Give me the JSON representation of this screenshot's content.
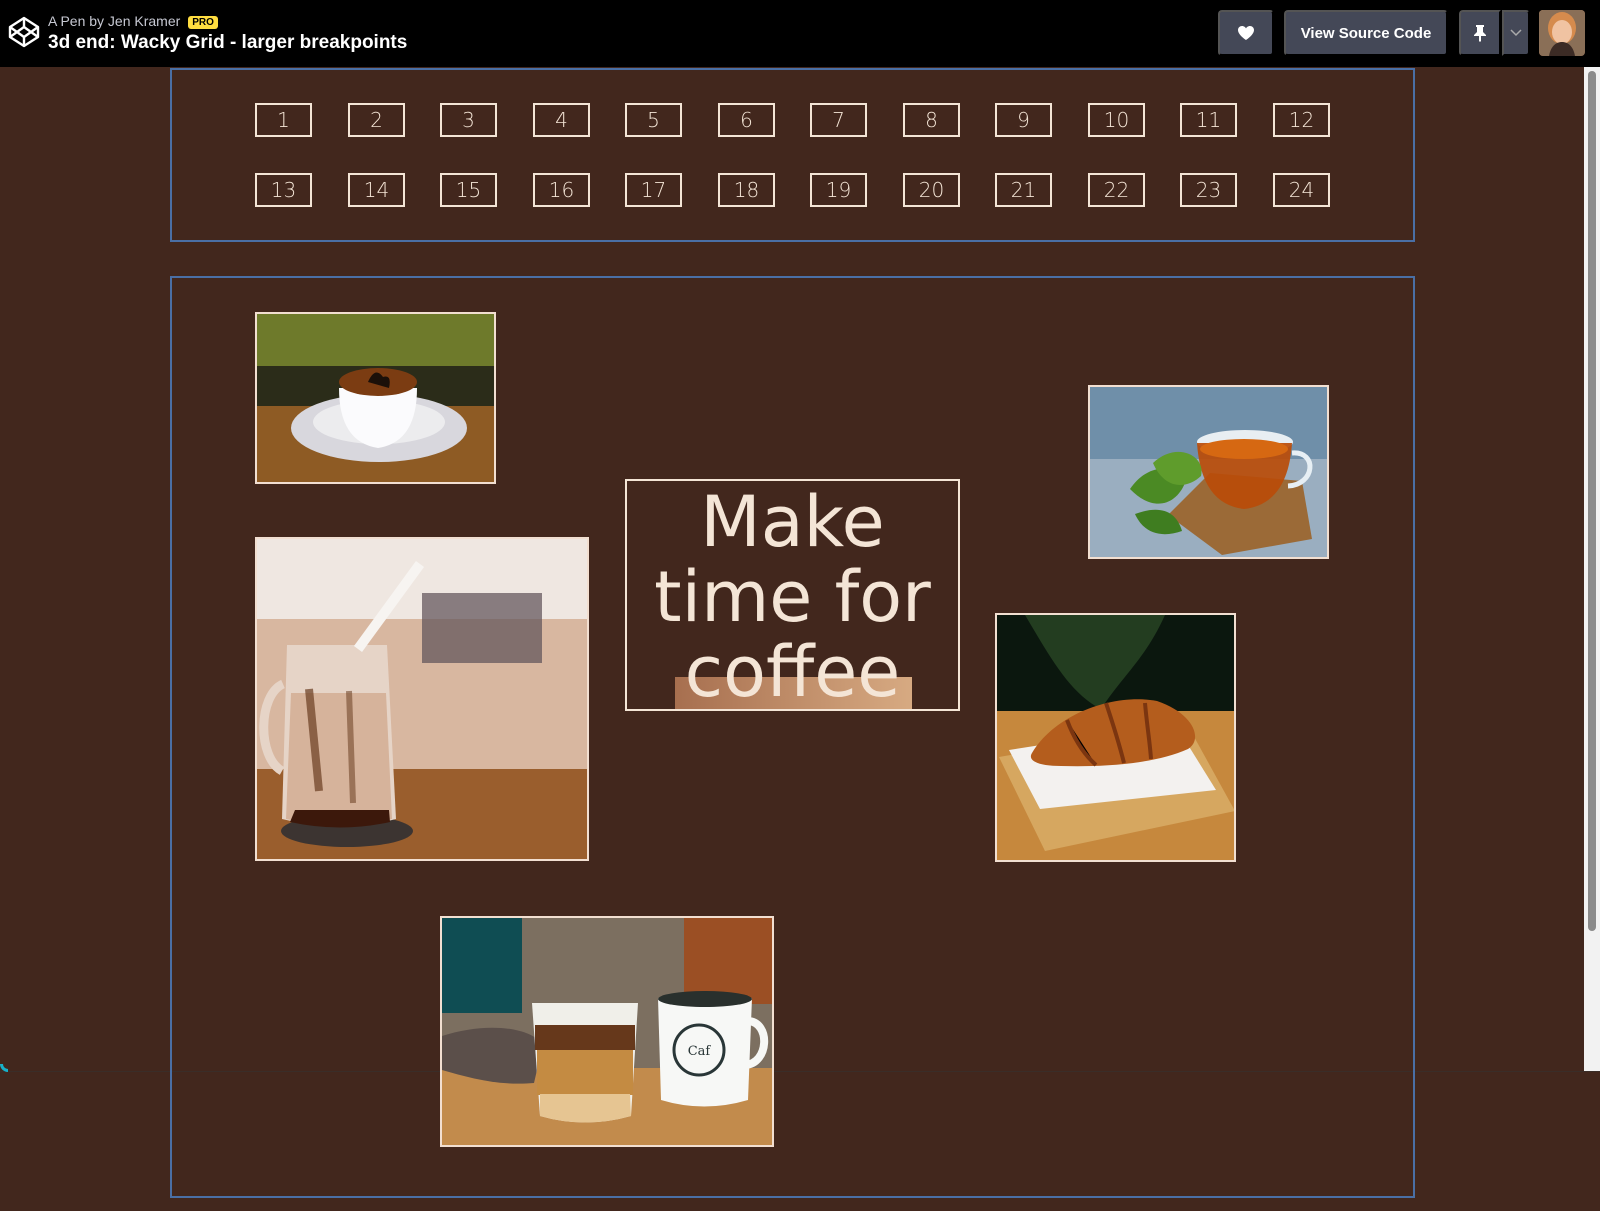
{
  "header": {
    "pen_by": "A Pen by Jen Kramer",
    "badge": "PRO",
    "title": "3d end: Wacky Grid - larger breakpoints",
    "buttons": {
      "like_icon": "heart-icon",
      "view_source": "View Source Code",
      "pin_icon": "pin-icon",
      "menu_icon": "chevron-down-icon"
    }
  },
  "grid_numbers": [
    "1",
    "2",
    "3",
    "4",
    "5",
    "6",
    "7",
    "8",
    "9",
    "10",
    "11",
    "12",
    "13",
    "14",
    "15",
    "16",
    "17",
    "18",
    "19",
    "20",
    "21",
    "22",
    "23",
    "24"
  ],
  "headline": {
    "line1": "Make",
    "line2": "time for",
    "line3": "coffee"
  },
  "colors": {
    "background": "#42271d",
    "text": "#f4e5d6",
    "border": "#4a6fa5",
    "accent": "#ffdd40"
  }
}
